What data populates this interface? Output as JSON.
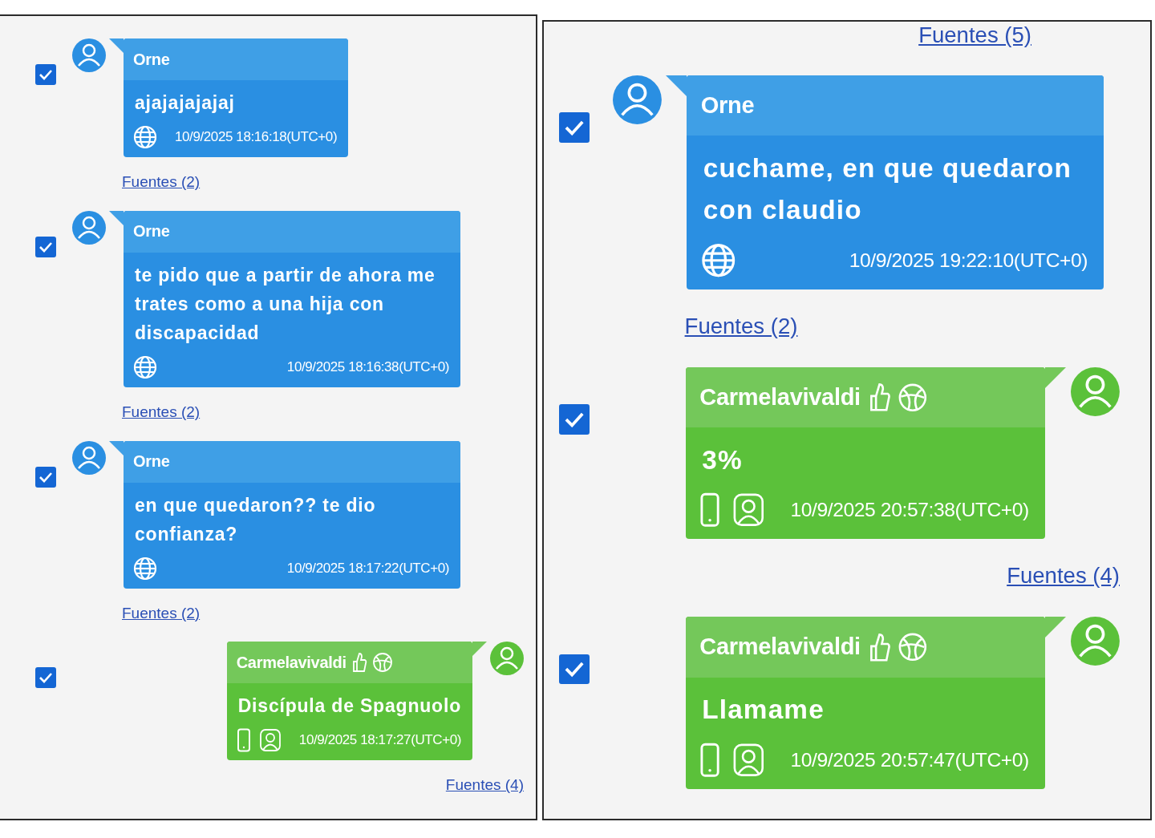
{
  "panels": [
    {
      "messages": [
        {
          "kind": "incoming",
          "checked": true,
          "sender": "Orne",
          "body": "ajajajajajaj",
          "timestamp": "10/9/2025 18:16:18(UTC+0)",
          "sources": "Fuentes (2)"
        },
        {
          "kind": "incoming",
          "checked": true,
          "sender": "Orne",
          "body": "te pido que a partir de ahora me trates como a una hija con discapacidad",
          "timestamp": "10/9/2025 18:16:38(UTC+0)",
          "sources": "Fuentes (2)"
        },
        {
          "kind": "incoming",
          "checked": true,
          "sender": "Orne",
          "body": "en que quedaron?? te dio confianza?",
          "timestamp": "10/9/2025 18:17:22(UTC+0)",
          "sources": "Fuentes (2)"
        },
        {
          "kind": "outgoing",
          "checked": true,
          "sender": "Carmelavivaldi",
          "body": "Discípula de Spagnuolo",
          "timestamp": "10/9/2025 18:17:27(UTC+0)",
          "sources": "Fuentes (4)"
        }
      ]
    },
    {
      "top_link": "Fuentes (5)",
      "messages": [
        {
          "kind": "incoming",
          "checked": true,
          "sender": "Orne",
          "body": "cuchame, en que quedaron con claudio",
          "timestamp": "10/9/2025 19:22:10(UTC+0)",
          "sources": "Fuentes (2)"
        },
        {
          "kind": "outgoing",
          "checked": true,
          "sender": "Carmelavivaldi",
          "body": "3%",
          "timestamp": "10/9/2025 20:57:38(UTC+0)",
          "sources": "Fuentes (4)"
        },
        {
          "kind": "outgoing",
          "checked": true,
          "sender": "Carmelavivaldi",
          "body": "Llamame",
          "timestamp": "10/9/2025 20:57:47(UTC+0)"
        }
      ]
    }
  ]
}
